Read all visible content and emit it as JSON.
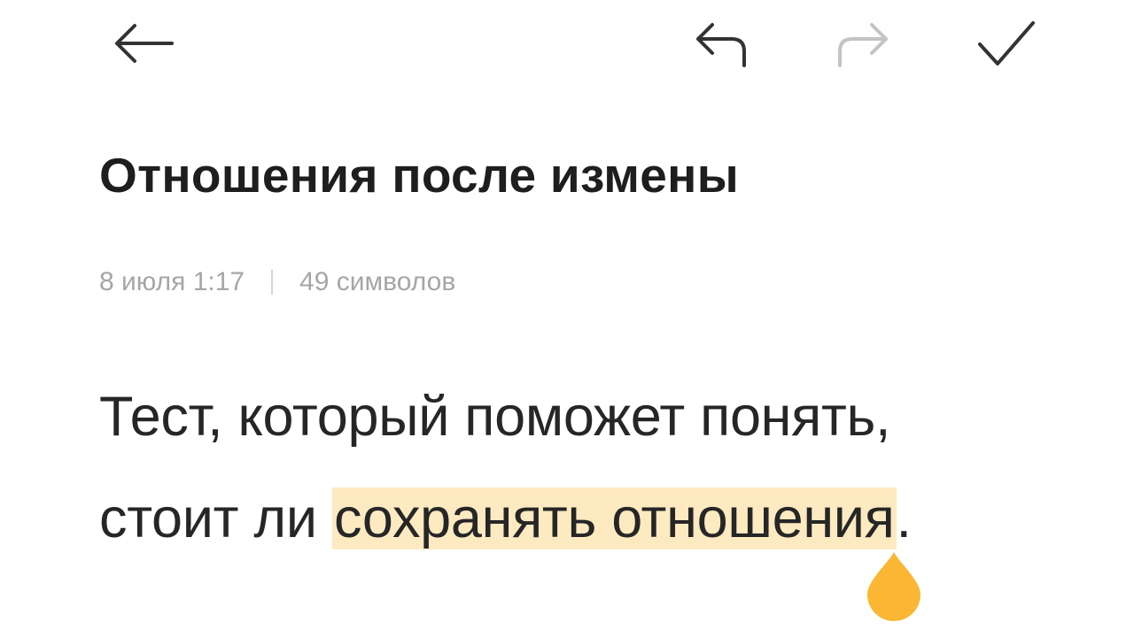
{
  "toolbar": {
    "back_icon": "arrow-left-icon",
    "undo_icon": "undo-icon",
    "redo_icon": "redo-icon",
    "confirm_icon": "check-icon",
    "redo_enabled": false
  },
  "note": {
    "title": "Отношения после измены",
    "date": "8 июля 1:17",
    "char_count": "49 символов",
    "body_line_1": "Тест, который поможет понять,",
    "body_line_2_before": "стоит ли ",
    "body_line_2_selected": "сохранять отношения",
    "body_line_2_after": "."
  },
  "colors": {
    "title": "#1e1e1e",
    "body_text": "#262626",
    "meta_text": "#a6a6a6",
    "selection_highlight": "#fdeac0",
    "cursor_handle": "#fbb733",
    "icon_active": "#333333",
    "icon_disabled": "#c4c4c4"
  }
}
